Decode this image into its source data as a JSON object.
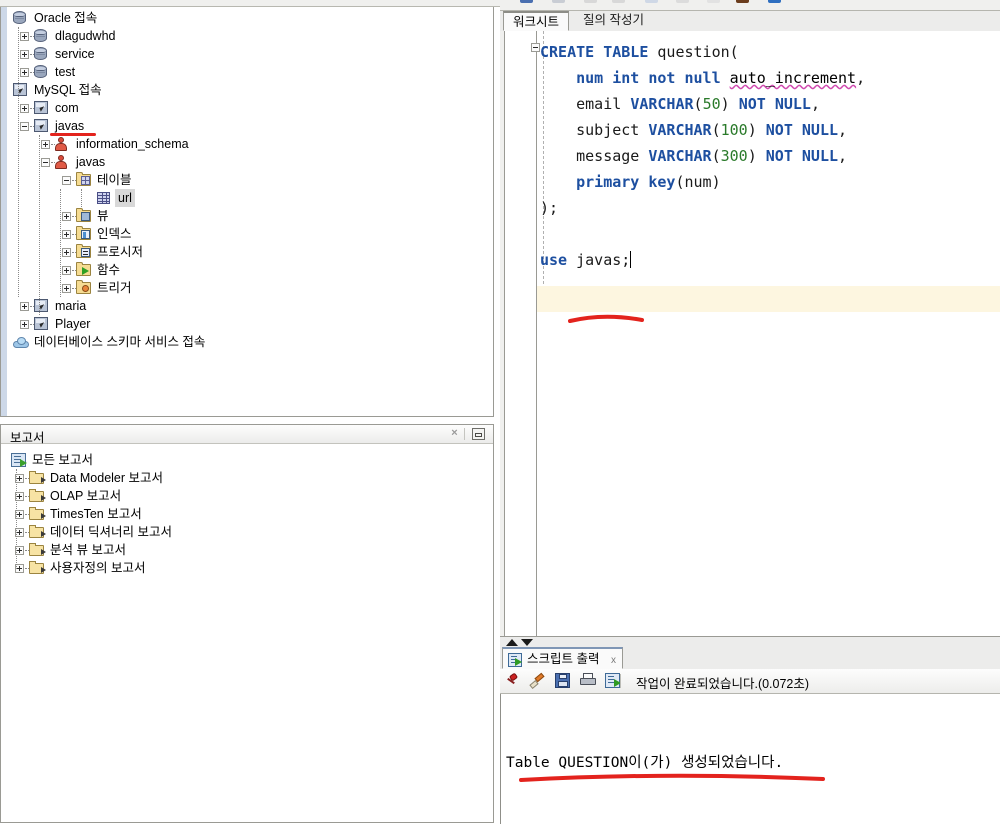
{
  "app": {
    "title": "SQL Developer",
    "accent": "#1d4fa0",
    "annotation_color": "#e3231d",
    "current_line_bg": "#fdf6e0"
  },
  "connections_panel": {
    "name": "Connections",
    "nodes": [
      {
        "label": "Oracle 접속",
        "icon": "database-icon",
        "depth": 0,
        "expander": "none",
        "selected": false
      },
      {
        "label": "dlagudwhd",
        "icon": "database-icon",
        "depth": 1,
        "expander": "plus",
        "selected": false
      },
      {
        "label": "service",
        "icon": "database-icon",
        "depth": 1,
        "expander": "plus",
        "selected": false
      },
      {
        "label": "test",
        "icon": "database-icon",
        "depth": 1,
        "expander": "plus",
        "selected": false
      },
      {
        "label": "MySQL 접속",
        "icon": "connection-icon",
        "depth": 0,
        "expander": "none",
        "selected": false
      },
      {
        "label": "com",
        "icon": "connection-icon",
        "depth": 1,
        "expander": "plus",
        "selected": false
      },
      {
        "label": "javas",
        "icon": "connection-icon",
        "depth": 1,
        "expander": "minus",
        "selected": false,
        "underlined": true
      },
      {
        "label": "information_schema",
        "icon": "user-icon",
        "depth": 2,
        "expander": "plus",
        "selected": false
      },
      {
        "label": "javas",
        "icon": "user-icon",
        "depth": 2,
        "expander": "minus",
        "selected": false
      },
      {
        "label": "테이블",
        "icon": "folder-table-icon",
        "depth": 3,
        "expander": "minus",
        "selected": false
      },
      {
        "label": "url",
        "icon": "table-icon",
        "depth": 4,
        "expander": "none",
        "selected": true
      },
      {
        "label": "뷰",
        "icon": "folder-view-icon",
        "depth": 3,
        "expander": "plus",
        "selected": false
      },
      {
        "label": "인덱스",
        "icon": "folder-index-icon",
        "depth": 3,
        "expander": "plus",
        "selected": false
      },
      {
        "label": "프로시저",
        "icon": "folder-procedure-icon",
        "depth": 3,
        "expander": "plus",
        "selected": false
      },
      {
        "label": "함수",
        "icon": "folder-function-icon",
        "depth": 3,
        "expander": "plus",
        "selected": false
      },
      {
        "label": "트리거",
        "icon": "folder-trigger-icon",
        "depth": 3,
        "expander": "plus",
        "selected": false
      },
      {
        "label": "maria",
        "icon": "connection-icon",
        "depth": 1,
        "expander": "plus",
        "selected": false
      },
      {
        "label": "Player",
        "icon": "connection-icon",
        "depth": 1,
        "expander": "plus",
        "selected": false
      },
      {
        "label": "데이터베이스 스키마 서비스 접속",
        "icon": "cloud-icon",
        "depth": 0,
        "expander": "none",
        "selected": false
      }
    ]
  },
  "reports_panel": {
    "title": "보고서",
    "close_label": "×",
    "minimize_label": "",
    "nodes": [
      {
        "label": "모든 보고서",
        "icon": "reports-root-icon",
        "depth": 0,
        "expander": "none"
      },
      {
        "label": "Data Modeler 보고서",
        "icon": "open-folder-icon",
        "depth": 1,
        "expander": "plus"
      },
      {
        "label": "OLAP 보고서",
        "icon": "open-folder-icon",
        "depth": 1,
        "expander": "plus"
      },
      {
        "label": "TimesTen 보고서",
        "icon": "open-folder-icon",
        "depth": 1,
        "expander": "plus"
      },
      {
        "label": "데이터 딕셔너리 보고서",
        "icon": "open-folder-icon",
        "depth": 1,
        "expander": "plus"
      },
      {
        "label": "분석 뷰 보고서",
        "icon": "open-folder-icon",
        "depth": 1,
        "expander": "plus"
      },
      {
        "label": "사용자정의 보고서",
        "icon": "open-folder-icon",
        "depth": 1,
        "expander": "plus"
      }
    ]
  },
  "worksheet": {
    "tabs": [
      {
        "label": "워크시트",
        "active": true
      },
      {
        "label": "질의 작성기",
        "active": false
      }
    ],
    "code_lines": [
      [
        {
          "t": "CREATE",
          "c": "kw"
        },
        {
          "t": " ",
          "c": "pl"
        },
        {
          "t": "TABLE",
          "c": "kw"
        },
        {
          "t": " question(",
          "c": "pl"
        }
      ],
      [
        {
          "t": "    ",
          "c": "pl"
        },
        {
          "t": "num",
          "c": "kw"
        },
        {
          "t": " ",
          "c": "pl"
        },
        {
          "t": "int",
          "c": "kw"
        },
        {
          "t": " ",
          "c": "pl"
        },
        {
          "t": "not",
          "c": "kw"
        },
        {
          "t": " ",
          "c": "pl"
        },
        {
          "t": "null",
          "c": "kw"
        },
        {
          "t": " ",
          "c": "pl"
        },
        {
          "t": "auto_increment",
          "c": "sq"
        },
        {
          "t": ",",
          "c": "pl"
        }
      ],
      [
        {
          "t": "    email ",
          "c": "pl"
        },
        {
          "t": "VARCHAR",
          "c": "kw"
        },
        {
          "t": "(",
          "c": "pl"
        },
        {
          "t": "50",
          "c": "num"
        },
        {
          "t": ") ",
          "c": "pl"
        },
        {
          "t": "NOT",
          "c": "kw"
        },
        {
          "t": " ",
          "c": "pl"
        },
        {
          "t": "NULL",
          "c": "kw"
        },
        {
          "t": ",",
          "c": "pl"
        }
      ],
      [
        {
          "t": "    subject ",
          "c": "pl"
        },
        {
          "t": "VARCHAR",
          "c": "kw"
        },
        {
          "t": "(",
          "c": "pl"
        },
        {
          "t": "100",
          "c": "num"
        },
        {
          "t": ") ",
          "c": "pl"
        },
        {
          "t": "NOT",
          "c": "kw"
        },
        {
          "t": " ",
          "c": "pl"
        },
        {
          "t": "NULL",
          "c": "kw"
        },
        {
          "t": ",",
          "c": "pl"
        }
      ],
      [
        {
          "t": "    message ",
          "c": "pl"
        },
        {
          "t": "VARCHAR",
          "c": "kw"
        },
        {
          "t": "(",
          "c": "pl"
        },
        {
          "t": "300",
          "c": "num"
        },
        {
          "t": ") ",
          "c": "pl"
        },
        {
          "t": "NOT",
          "c": "kw"
        },
        {
          "t": " ",
          "c": "pl"
        },
        {
          "t": "NULL",
          "c": "kw"
        },
        {
          "t": ",",
          "c": "pl"
        }
      ],
      [
        {
          "t": "    ",
          "c": "pl"
        },
        {
          "t": "primary",
          "c": "kw"
        },
        {
          "t": " ",
          "c": "pl"
        },
        {
          "t": "key",
          "c": "kw"
        },
        {
          "t": "(num)",
          "c": "pl"
        }
      ],
      [
        {
          "t": ");",
          "c": "pl"
        }
      ],
      [
        {
          "t": "",
          "c": "pl"
        }
      ],
      [
        {
          "t": "use",
          "c": "kw"
        },
        {
          "t": " javas;",
          "c": "pl"
        }
      ]
    ],
    "current_line_text": "use javas;"
  },
  "script_output": {
    "tab_label": "스크립트 출력",
    "tab_close": "x",
    "status_message": "작업이 완료되었습니다.(0.072초)",
    "toolbar_icons": [
      "pin-icon",
      "eraser-icon",
      "save-icon",
      "print-icon",
      "run-script-icon"
    ],
    "result_text": "Table QUESTION이(가) 생성되었습니다."
  }
}
